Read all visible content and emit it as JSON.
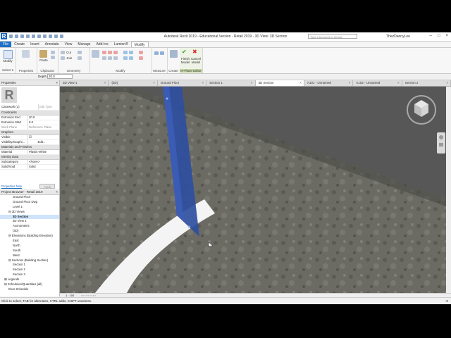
{
  "app": {
    "title": "Autodesk Revit 2019 - Educational Version - Retail 2019 - 3D View: 3D Section",
    "search_placeholder": "Type a keyword or phrase",
    "user": "ThezDannyLee",
    "logo_letter": "R"
  },
  "menu": {
    "tabs": [
      "File",
      "Create",
      "Insert",
      "Annotate",
      "View",
      "Manage",
      "Add-Ins",
      "Lumion®",
      "Modify"
    ],
    "active": "Modify"
  },
  "ribbon": {
    "modify_label": "Modify",
    "properties_label": "Properties",
    "paste_label": "Paste",
    "cut_label": "Cut",
    "join_label": "Join",
    "finish_label": "Finish Model",
    "cancel_label": "Cancel Model",
    "groups": {
      "select": "Select ▾",
      "properties": "Properties",
      "clipboard": "Clipboard",
      "geometry": "Geometry",
      "modify": "Modify",
      "measure": "Measure",
      "create": "Create",
      "inplace": "In-Place Editor"
    }
  },
  "options_bar": {
    "depth_label": "Depth",
    "depth_value": "20.0"
  },
  "properties": {
    "title": "Properties",
    "close": "×",
    "type_selector": "Casework (1)",
    "edit_type": "Edit Type",
    "sections": {
      "constraints": "Constraints",
      "graphics": "Graphics",
      "materials": "Materials and Finishes",
      "identity": "Identity Data"
    },
    "rows": {
      "extrusion_end": {
        "label": "Extrusion End",
        "value": "20.0"
      },
      "extrusion_start": {
        "label": "Extrusion Start",
        "value": "0.0"
      },
      "work_plane": {
        "label": "Work Plane",
        "value": "Reference Plane"
      },
      "visible": {
        "label": "Visible",
        "value": "☑"
      },
      "visibility_graphics": {
        "label": "Visibility/Graphi...",
        "value": "Edit..."
      },
      "material": {
        "label": "Material",
        "value": "Plastic-White"
      },
      "subcategory": {
        "label": "Subcategory",
        "value": "<None>"
      },
      "solid_void": {
        "label": "Solid/Void",
        "value": "Solid"
      }
    },
    "help_link": "Properties help",
    "apply": "Apply"
  },
  "browser": {
    "title": "Project Browser - Retail 2019",
    "items": [
      {
        "indent": 3,
        "label": "Ground Floor",
        "selected": false
      },
      {
        "indent": 3,
        "label": "Ground Floor Dwg",
        "selected": false
      },
      {
        "indent": 3,
        "label": "Level 1",
        "selected": false
      },
      {
        "indent": 2,
        "label": "⊟ 3D Views",
        "selected": false
      },
      {
        "indent": 3,
        "label": "3D Section",
        "selected": true
      },
      {
        "indent": 3,
        "label": "3D View 1",
        "selected": false
      },
      {
        "indent": 3,
        "label": "Axonometric",
        "selected": false
      },
      {
        "indent": 3,
        "label": "{3D}",
        "selected": false
      },
      {
        "indent": 2,
        "label": "⊟ Elevations (Building Elevation)",
        "selected": false
      },
      {
        "indent": 3,
        "label": "East",
        "selected": false
      },
      {
        "indent": 3,
        "label": "North",
        "selected": false
      },
      {
        "indent": 3,
        "label": "South",
        "selected": false
      },
      {
        "indent": 3,
        "label": "West",
        "selected": false
      },
      {
        "indent": 2,
        "label": "⊟ Sections (Building Section)",
        "selected": false
      },
      {
        "indent": 3,
        "label": "Section 1",
        "selected": false
      },
      {
        "indent": 3,
        "label": "Section 2",
        "selected": false
      },
      {
        "indent": 3,
        "label": "Section 3",
        "selected": false
      },
      {
        "indent": 1,
        "label": "⊞ Legends",
        "selected": false
      },
      {
        "indent": 1,
        "label": "⊟ Schedules/Quantities (all)",
        "selected": false
      },
      {
        "indent": 2,
        "label": "Door Schedule",
        "selected": false
      }
    ]
  },
  "view_tabs": [
    {
      "label": "3D View 1"
    },
    {
      "label": "{3D}"
    },
    {
      "label": "Ground Floor"
    },
    {
      "label": "Section 1"
    },
    {
      "label": "3D Section",
      "active": true
    },
    {
      "label": "A101 - Unnamed"
    },
    {
      "label": "A102 - Unnamed"
    },
    {
      "label": "Section 2"
    }
  ],
  "view_bar": {
    "scale": "1 : 100"
  },
  "status": {
    "text": "Click to select, TAB for alternates, CTRL adds, SHIFT unselects.",
    "right": ":0"
  },
  "colors": {
    "accent": "#1e6fc8",
    "extrusion": "#2f4ea0",
    "floor": "#6e6e6e",
    "background": "#595959"
  }
}
